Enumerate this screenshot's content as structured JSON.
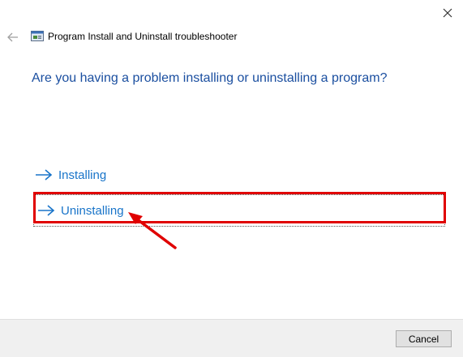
{
  "window": {
    "title": "Program Install and Uninstall troubleshooter",
    "close_icon": "close-icon",
    "back_icon": "back-arrow-icon"
  },
  "main": {
    "question": "Are you having a problem installing or uninstalling a program?",
    "options": [
      {
        "label": "Installing",
        "icon": "arrow-right-icon",
        "selected": false
      },
      {
        "label": "Uninstalling",
        "icon": "arrow-right-icon",
        "selected": true
      }
    ]
  },
  "footer": {
    "cancel_label": "Cancel"
  },
  "colors": {
    "question_text": "#1b4fa0",
    "option_text": "#1874c9",
    "highlight": "#e00000",
    "footer_bg": "#f0f0f0"
  }
}
